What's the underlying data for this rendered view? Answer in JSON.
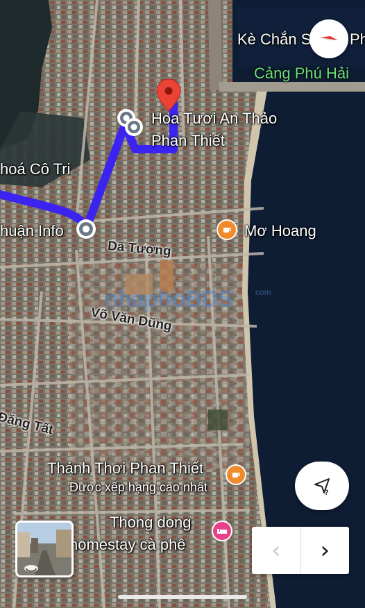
{
  "map": {
    "places": [
      {
        "name": "Kè Chắn S",
        "name2": "Ph"
      },
      {
        "name": "Cảng Phú Hải"
      },
      {
        "name": "Hoa Tươi An Thảo",
        "line2": "Phan Thiết"
      },
      {
        "name": "hoá Cô Tri"
      },
      {
        "name": "huận Info"
      },
      {
        "name": "Mơ Hoang"
      },
      {
        "name": "Thảnh Thơi Phan Thiết",
        "line2": "Được xếp hạng cao nhất"
      },
      {
        "name": "Thong dong",
        "line2": "homestay cà phê"
      }
    ],
    "streets": [
      "Dã Tượng",
      "Võ Văn Dũng",
      "Đặng Tất"
    ],
    "watermark": {
      "text": "nhaphoBDS",
      "small": "com"
    },
    "colors": {
      "route": "#3b24f0",
      "pin": "#ea4335",
      "cafe": "#f08a2c",
      "hotel": "#e8418a",
      "sea": "#0e1d33"
    }
  },
  "controls": {
    "compass": "compass-icon",
    "recenter": "navigation-arrow-icon",
    "prev": "‹",
    "next": "›",
    "streetview": "street-view-thumbnail"
  }
}
